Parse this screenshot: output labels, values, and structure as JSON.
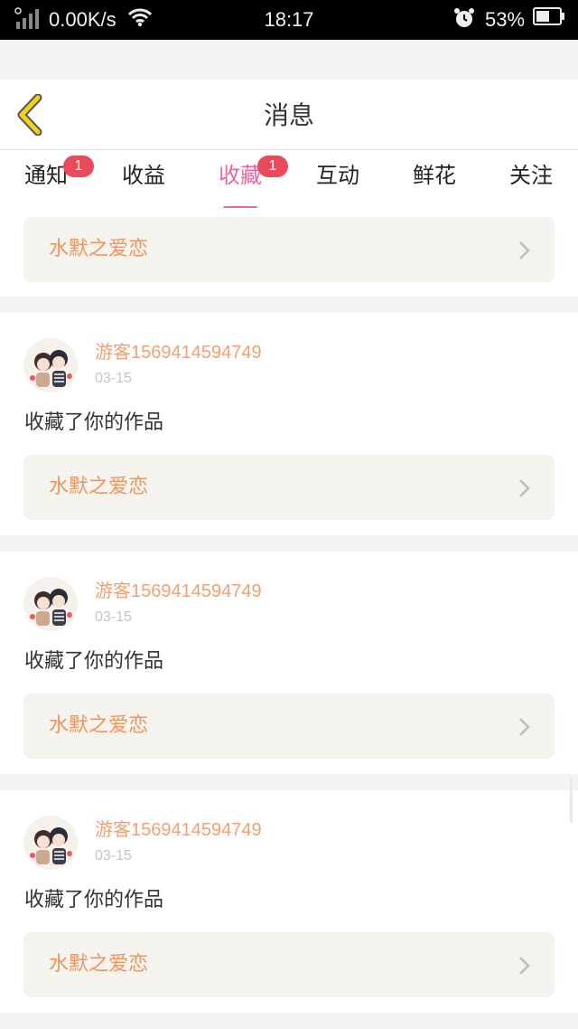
{
  "status_bar": {
    "net_speed": "0.00K/s",
    "time": "18:17",
    "battery": "53%",
    "icons": [
      "signal-icon",
      "wifi-icon",
      "alarm-icon",
      "battery-icon"
    ]
  },
  "header": {
    "title": "消息",
    "back_icon": "chevron-left-icon"
  },
  "tabs": [
    {
      "label": "通知",
      "badge": "1",
      "active": false
    },
    {
      "label": "收益",
      "badge": "",
      "active": false
    },
    {
      "label": "收藏",
      "badge": "1",
      "active": true
    },
    {
      "label": "互动",
      "badge": "",
      "active": false
    },
    {
      "label": "鲜花",
      "badge": "",
      "active": false
    },
    {
      "label": "关注",
      "badge": "",
      "active": false
    }
  ],
  "top_card": {
    "work_title": "水默之爱恋"
  },
  "items": [
    {
      "username": "游客1569414594749",
      "date": "03-15",
      "action": "收藏了你的作品",
      "work_title": "水默之爱恋"
    },
    {
      "username": "游客1569414594749",
      "date": "03-15",
      "action": "收藏了你的作品",
      "work_title": "水默之爱恋"
    },
    {
      "username": "游客1569414594749",
      "date": "03-15",
      "action": "收藏了你的作品",
      "work_title": "水默之爱恋"
    }
  ],
  "colors": {
    "accent_pink": "#e7679f",
    "badge_red": "#e94b5a",
    "work_title_orange": "#f0945e",
    "username_orange": "#f0a070",
    "back_arrow_yellow": "#f5d21a"
  }
}
